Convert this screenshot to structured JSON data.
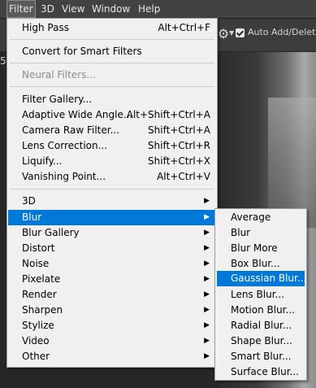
{
  "menubar": {
    "items": [
      {
        "label": "Filter"
      },
      {
        "label": "3D"
      },
      {
        "label": "View"
      },
      {
        "label": "Window"
      },
      {
        "label": "Help"
      }
    ]
  },
  "options_bar": {
    "gear_icon": "gear-icon",
    "auto_add_delete": "Auto Add/Delete",
    "auto_add_checked": true,
    "partial_zoom_digit": "5"
  },
  "filter_menu": {
    "items": [
      {
        "label": "High Pass",
        "shortcut": "Alt+Ctrl+F"
      },
      {
        "label": "Convert for Smart Filters"
      },
      {
        "label": "Neural Filters...",
        "disabled": true
      },
      {
        "label": "Filter Gallery..."
      },
      {
        "label": "Adaptive Wide Angle...",
        "shortcut": "Alt+Shift+Ctrl+A"
      },
      {
        "label": "Camera Raw Filter...",
        "shortcut": "Shift+Ctrl+A"
      },
      {
        "label": "Lens Correction...",
        "shortcut": "Shift+Ctrl+R"
      },
      {
        "label": "Liquify...",
        "shortcut": "Shift+Ctrl+X"
      },
      {
        "label": "Vanishing Point...",
        "shortcut": "Alt+Ctrl+V"
      },
      {
        "label": "3D",
        "submenu": true
      },
      {
        "label": "Blur",
        "submenu": true,
        "highlighted": true
      },
      {
        "label": "Blur Gallery",
        "submenu": true
      },
      {
        "label": "Distort",
        "submenu": true
      },
      {
        "label": "Noise",
        "submenu": true
      },
      {
        "label": "Pixelate",
        "submenu": true
      },
      {
        "label": "Render",
        "submenu": true
      },
      {
        "label": "Sharpen",
        "submenu": true
      },
      {
        "label": "Stylize",
        "submenu": true
      },
      {
        "label": "Video",
        "submenu": true
      },
      {
        "label": "Other",
        "submenu": true
      }
    ]
  },
  "blur_submenu": {
    "items": [
      {
        "label": "Average"
      },
      {
        "label": "Blur"
      },
      {
        "label": "Blur More"
      },
      {
        "label": "Box Blur..."
      },
      {
        "label": "Gaussian Blur...",
        "highlighted": true
      },
      {
        "label": "Lens Blur..."
      },
      {
        "label": "Motion Blur..."
      },
      {
        "label": "Radial Blur..."
      },
      {
        "label": "Shape Blur..."
      },
      {
        "label": "Smart Blur..."
      },
      {
        "label": "Surface Blur..."
      }
    ]
  },
  "colors": {
    "highlight": "#0078d7",
    "menu_bg": "#f0f0f0",
    "app_bg": "#424242"
  }
}
